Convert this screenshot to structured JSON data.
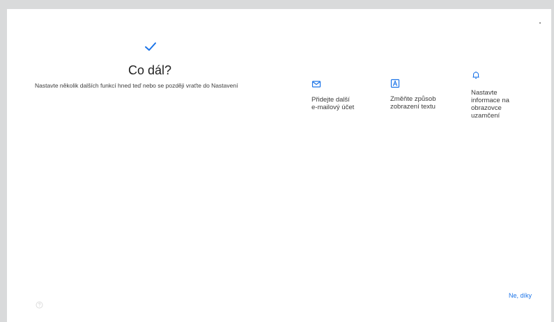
{
  "setup": {
    "title": "Co dál?",
    "subtitle": "Nastavte několik dalších funkcí hned teď nebo se později vraťte do Nastavení",
    "options": [
      {
        "icon": "envelope-icon",
        "label": "Přidejte další\ne-mailový účet"
      },
      {
        "icon": "text-display-icon",
        "label": "Změňte způsob\nzobrazení textu"
      },
      {
        "icon": "bell-icon",
        "label": "Nastavte\ninformace na\nobrazovce\nuzamčení"
      }
    ],
    "skip_label": "Ne, díky"
  },
  "colors": {
    "accent": "#1a73e8",
    "background": "#ffffff",
    "frame": "#d9dadb"
  }
}
